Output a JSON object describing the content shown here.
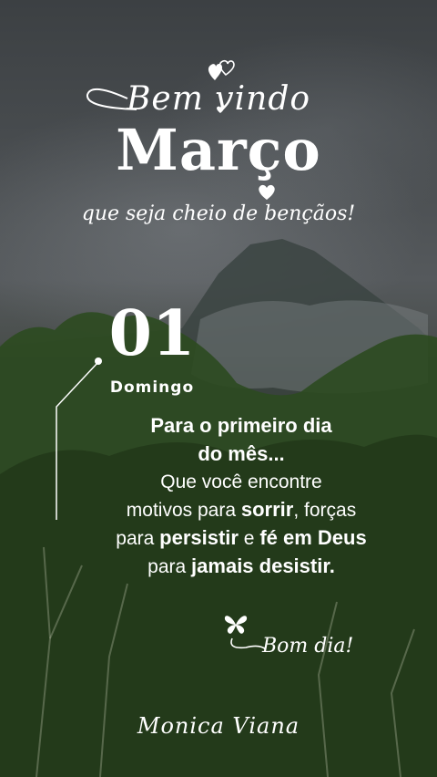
{
  "header": {
    "welcome": "Bem vindo",
    "month": "Março",
    "subtitle": "que seja cheio de bençãos!"
  },
  "date": {
    "day": "01",
    "weekday": "Domingo"
  },
  "message": {
    "line1": "Para o primeiro dia",
    "line2": "do mês...",
    "line3": "Que você encontre",
    "line4_pre": "motivos para ",
    "line4_bold": "sorrir",
    "line4_post": ", forças",
    "line5_pre": "para ",
    "line5_bold1": "persistir",
    "line5_mid": " e ",
    "line5_bold2": "fé em Deus",
    "line6_pre": "para ",
    "line6_bold": "jamais desistir."
  },
  "closing": {
    "greeting": "Bom dia!",
    "signature": "Monica Viana"
  },
  "decor": {
    "icons": [
      "double-heart-icon",
      "small-heart-icon",
      "heart-icon",
      "butterfly-icon"
    ]
  }
}
